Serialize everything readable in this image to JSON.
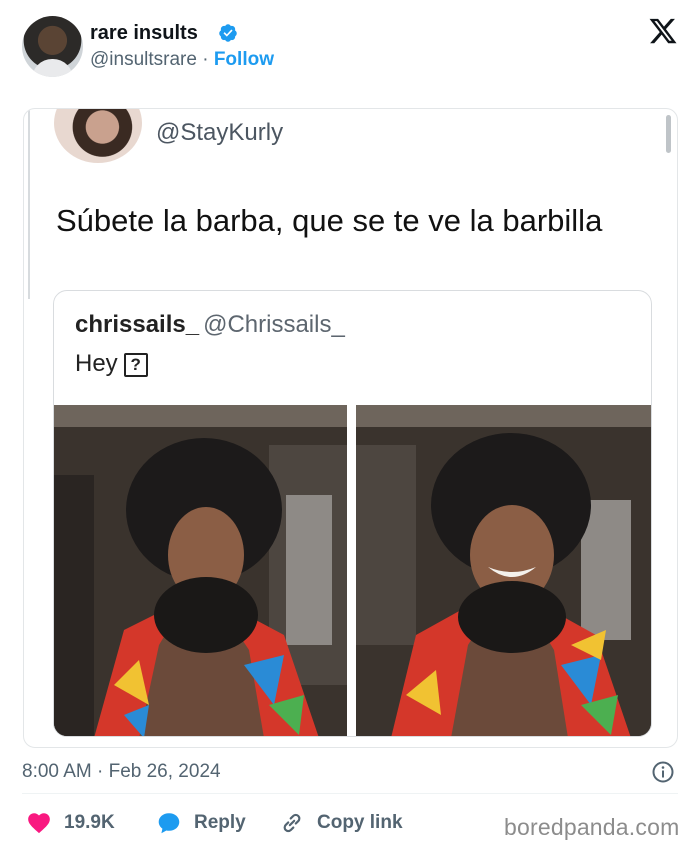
{
  "tweet": {
    "author": {
      "display_name": "rare insults",
      "handle": "@insultsrare",
      "separator": "·",
      "follow_label": "Follow",
      "verified": true
    },
    "timestamp": "8:00 AM · Feb 26, 2024",
    "actions": {
      "likes": "19.9K",
      "reply_label": "Reply",
      "copy_link_label": "Copy link"
    }
  },
  "embedded_screenshot": {
    "handle": "@StayKurly",
    "text": "Súbete la barba, que se te ve la barbilla",
    "quoted": {
      "name": "chrissails_",
      "handle": "@Chrissails_",
      "text": "Hey",
      "emoji_placeholder": "?"
    }
  },
  "watermark": "boredpanda.com",
  "colors": {
    "accent": "#1d9bf0",
    "like": "#f91880",
    "muted": "#536471"
  },
  "icons": [
    "verified-badge-icon",
    "x-logo-icon",
    "info-icon",
    "heart-icon",
    "reply-bubble-icon",
    "link-icon"
  ]
}
